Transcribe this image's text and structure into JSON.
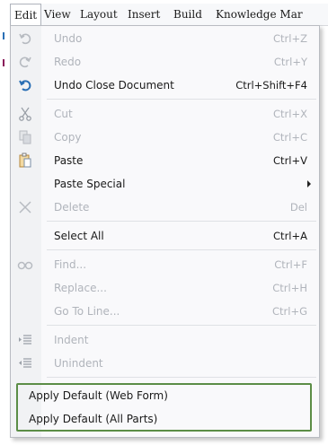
{
  "menubar": {
    "items": [
      "Edit",
      "View",
      "Layout",
      "Insert",
      "Build",
      "Knowledge Mar"
    ]
  },
  "menu": {
    "undo": {
      "label": "Undo",
      "shortcut": "Ctrl+Z"
    },
    "redo": {
      "label": "Redo",
      "shortcut": "Ctrl+Y"
    },
    "undo_close": {
      "label": "Undo Close Document",
      "shortcut": "Ctrl+Shift+F4"
    },
    "cut": {
      "label": "Cut",
      "shortcut": "Ctrl+X"
    },
    "copy": {
      "label": "Copy",
      "shortcut": "Ctrl+C"
    },
    "paste": {
      "label": "Paste",
      "shortcut": "Ctrl+V"
    },
    "paste_special": {
      "label": "Paste Special"
    },
    "delete": {
      "label": "Delete",
      "shortcut": "Del"
    },
    "select_all": {
      "label": "Select All",
      "shortcut": "Ctrl+A"
    },
    "find": {
      "label": "Find...",
      "shortcut": "Ctrl+F"
    },
    "replace": {
      "label": "Replace...",
      "shortcut": "Ctrl+H"
    },
    "go_to_line": {
      "label": "Go To Line...",
      "shortcut": "Ctrl+G"
    },
    "indent": {
      "label": "Indent"
    },
    "unindent": {
      "label": "Unindent"
    },
    "apply_default_web": {
      "label": "Apply Default (Web Form)"
    },
    "apply_default_all": {
      "label": "Apply Default (All Parts)"
    }
  },
  "colors": {
    "highlight_border": "#5b8d46",
    "disabled_text": "#b0b4bb",
    "undo_close_icon": "#2a6fb5"
  },
  "icons": {
    "undo": "undo-icon",
    "redo": "redo-icon",
    "undo_close": "undo-close-icon",
    "cut": "scissors-icon",
    "copy": "copy-icon",
    "paste": "clipboard-icon",
    "delete": "x-icon",
    "find": "binoculars-icon",
    "indent": "indent-icon",
    "unindent": "unindent-icon"
  }
}
